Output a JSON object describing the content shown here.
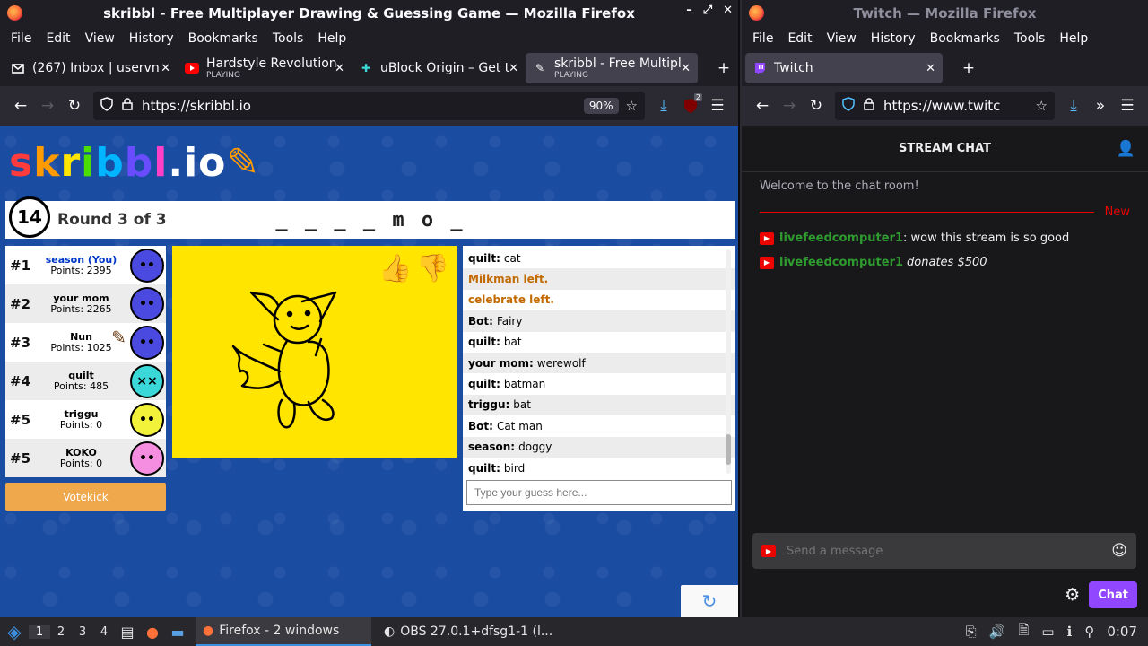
{
  "left_window": {
    "title": "skribbl - Free Multiplayer Drawing & Guessing Game — Mozilla Firefox",
    "menu": [
      "File",
      "Edit",
      "View",
      "History",
      "Bookmarks",
      "Tools",
      "Help"
    ],
    "tabs": [
      {
        "label": "(267) Inbox | uservn",
        "sub": "",
        "icon": "gmail-icon"
      },
      {
        "label": "Hardstyle Revolution",
        "sub": "PLAYING",
        "icon": "youtube-icon"
      },
      {
        "label": "uBlock Origin – Get t",
        "sub": "",
        "icon": "ublock-icon"
      },
      {
        "label": "skribbl - Free Multipl",
        "sub": "PLAYING",
        "icon": "skribbl-icon"
      }
    ],
    "url": "https://skribbl.io",
    "zoom": "90%",
    "extension_badge": "2"
  },
  "skribbl": {
    "logo": "skribbl.io",
    "timer": "14",
    "round": "Round 3 of 3",
    "word_hint": "_ _ _ _ m o _",
    "players": [
      {
        "rank": "#1",
        "name": "season (You)",
        "points": "Points: 2395",
        "you": true,
        "color": "#4a4ae0"
      },
      {
        "rank": "#2",
        "name": "your mom",
        "points": "Points: 2265",
        "you": false,
        "color": "#4a4ae0"
      },
      {
        "rank": "#3",
        "name": "Nun",
        "points": "Points: 1025",
        "you": false,
        "color": "#4a4ae0"
      },
      {
        "rank": "#4",
        "name": "quilt",
        "points": "Points: 485",
        "you": false,
        "color": "#3ad8d8"
      },
      {
        "rank": "#5",
        "name": "triggu",
        "points": "Points: 0",
        "you": false,
        "color": "#f2f23a"
      },
      {
        "rank": "#5",
        "name": "KOKO",
        "points": "Points: 0",
        "you": false,
        "color": "#f58ee0"
      }
    ],
    "votekick": "Votekick",
    "chat": [
      {
        "user": "quilt:",
        "text": "cat",
        "sys": false
      },
      {
        "user": "",
        "text": "Milkman left.",
        "sys": true
      },
      {
        "user": "",
        "text": "celebrate left.",
        "sys": true
      },
      {
        "user": "Bot:",
        "text": "Fairy",
        "sys": false
      },
      {
        "user": "quilt:",
        "text": "bat",
        "sys": false
      },
      {
        "user": "your mom:",
        "text": "werewolf",
        "sys": false
      },
      {
        "user": "quilt:",
        "text": "batman",
        "sys": false
      },
      {
        "user": "triggu:",
        "text": "bat",
        "sys": false
      },
      {
        "user": "Bot:",
        "text": "Cat man",
        "sys": false
      },
      {
        "user": "season:",
        "text": "doggy",
        "sys": false
      },
      {
        "user": "quilt:",
        "text": "bird",
        "sys": false
      }
    ],
    "guess_placeholder": "Type your guess here..."
  },
  "right_window": {
    "title": "Twitch — Mozilla Firefox",
    "menu": [
      "File",
      "Edit",
      "View",
      "History",
      "Bookmarks",
      "Tools",
      "Help"
    ],
    "tab": "Twitch",
    "url": "https://www.twitc",
    "chat_header": "STREAM CHAT",
    "welcome": "Welcome to the chat room!",
    "new_label": "New",
    "messages": [
      {
        "user": "livefeedcomputer1",
        "text": ": wow this stream is so good",
        "italic": false
      },
      {
        "user": "livefeedcomputer1",
        "text": "donates $500",
        "italic": true
      }
    ],
    "send_placeholder": "Send a message",
    "chat_button": "Chat"
  },
  "taskbar": {
    "workspaces": [
      "1",
      "2",
      "3",
      "4"
    ],
    "tasks": [
      {
        "label": "Firefox - 2 windows",
        "active": true
      },
      {
        "label": "OBS 27.0.1+dfsg1-1 (l...",
        "active": false
      }
    ],
    "clock": "0:07"
  }
}
